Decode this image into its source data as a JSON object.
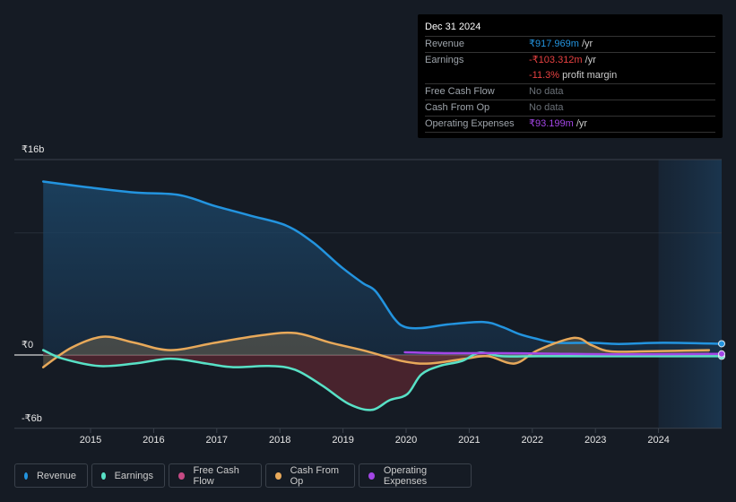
{
  "tooltip": {
    "date": "Dec 31 2024",
    "rows": [
      {
        "label": "Revenue",
        "value": "₹917.969m",
        "unit": " /yr",
        "color": "#2394df"
      },
      {
        "label": "Earnings",
        "value": "-₹103.312m",
        "unit": " /yr",
        "color": "#e64141"
      },
      {
        "label": "",
        "value": "-11.3%",
        "unit": " profit margin",
        "color": "#e64141"
      },
      {
        "label": "Free Cash Flow",
        "value": "No data",
        "unit": "",
        "color": "#6b7178"
      },
      {
        "label": "Cash From Op",
        "value": "No data",
        "unit": "",
        "color": "#6b7178"
      },
      {
        "label": "Operating Expenses",
        "value": "₹93.199m",
        "unit": " /yr",
        "color": "#a346e6"
      }
    ]
  },
  "legend": [
    {
      "label": "Revenue",
      "color": "#2394df"
    },
    {
      "label": "Earnings",
      "color": "#58e1c6"
    },
    {
      "label": "Free Cash Flow",
      "color": "#c64a84"
    },
    {
      "label": "Cash From Op",
      "color": "#e8a95a"
    },
    {
      "label": "Operating Expenses",
      "color": "#a346e6"
    }
  ],
  "chart_data": {
    "type": "area",
    "title": "",
    "xlabel": "",
    "ylabel": "",
    "y_unit": "₹ billions",
    "ylim": [
      -6,
      16
    ],
    "xlim": [
      2014.2,
      2025.0
    ],
    "y_tick_labels": [
      {
        "value": 16,
        "label": "₹16b"
      },
      {
        "value": 0,
        "label": "₹0"
      },
      {
        "value": -6,
        "label": "-₹6b"
      }
    ],
    "gridlines": [
      16,
      10,
      0,
      -6
    ],
    "x_ticks": [
      2015,
      2016,
      2017,
      2018,
      2019,
      2020,
      2021,
      2022,
      2023,
      2024
    ],
    "highlight_range": [
      2024.0,
      2025.0
    ],
    "legend_position": "bottom-left",
    "series": [
      {
        "name": "Revenue",
        "color": "#2394df",
        "fill": true,
        "x": [
          2014.25,
          2015.0,
          2015.7,
          2016.4,
          2016.97,
          2017.54,
          2018.1,
          2018.53,
          2018.95,
          2019.31,
          2019.52,
          2019.81,
          2019.98,
          2020.24,
          2020.66,
          2021.23,
          2021.52,
          2021.8,
          2022.09,
          2022.37,
          2022.94,
          2023.37,
          2024.07,
          2025.0
        ],
        "values": [
          14.2,
          13.7,
          13.3,
          13.1,
          12.2,
          11.4,
          10.6,
          9.2,
          7.3,
          5.9,
          5.2,
          3.0,
          2.3,
          2.2,
          2.5,
          2.7,
          2.3,
          1.7,
          1.3,
          1.0,
          1.0,
          0.9,
          1.0,
          0.92
        ]
      },
      {
        "name": "Earnings",
        "color": "#58e1c6",
        "fill": true,
        "x": [
          2014.25,
          2014.56,
          2015.13,
          2015.7,
          2016.27,
          2016.83,
          2017.26,
          2017.83,
          2018.24,
          2018.67,
          2019.09,
          2019.45,
          2019.74,
          2020.02,
          2020.24,
          2020.53,
          2020.88,
          2021.17,
          2021.52,
          2022.09,
          2022.94,
          2023.8,
          2025.0
        ],
        "values": [
          0.4,
          -0.3,
          -0.9,
          -0.7,
          -0.3,
          -0.7,
          -1.0,
          -0.9,
          -1.2,
          -2.5,
          -4.0,
          -4.5,
          -3.7,
          -3.2,
          -1.6,
          -0.9,
          -0.5,
          0.2,
          -0.1,
          -0.1,
          -0.1,
          -0.1,
          -0.1
        ]
      },
      {
        "name": "Free Cash Flow",
        "color": "#c64a84",
        "fill": false,
        "x": [],
        "values": []
      },
      {
        "name": "Cash From Op",
        "color": "#e8a95a",
        "fill": true,
        "x": [
          2014.25,
          2014.7,
          2015.2,
          2015.7,
          2016.27,
          2016.97,
          2017.68,
          2018.24,
          2018.81,
          2019.38,
          2019.94,
          2020.37,
          2020.94,
          2021.3,
          2021.72,
          2022.09,
          2022.66,
          2022.94,
          2023.23,
          2023.8,
          2024.8
        ],
        "values": [
          -1.0,
          0.6,
          1.5,
          1.0,
          0.4,
          1.0,
          1.6,
          1.8,
          1.0,
          0.3,
          -0.5,
          -0.7,
          -0.3,
          -0.1,
          -0.7,
          0.4,
          1.4,
          0.8,
          0.3,
          0.3,
          0.4
        ]
      },
      {
        "name": "Operating Expenses",
        "color": "#a346e6",
        "fill": false,
        "x": [
          2019.98,
          2020.66,
          2021.52,
          2022.37,
          2023.51,
          2025.0
        ],
        "values": [
          0.22,
          0.15,
          0.15,
          0.1,
          0.05,
          0.09
        ]
      }
    ]
  }
}
